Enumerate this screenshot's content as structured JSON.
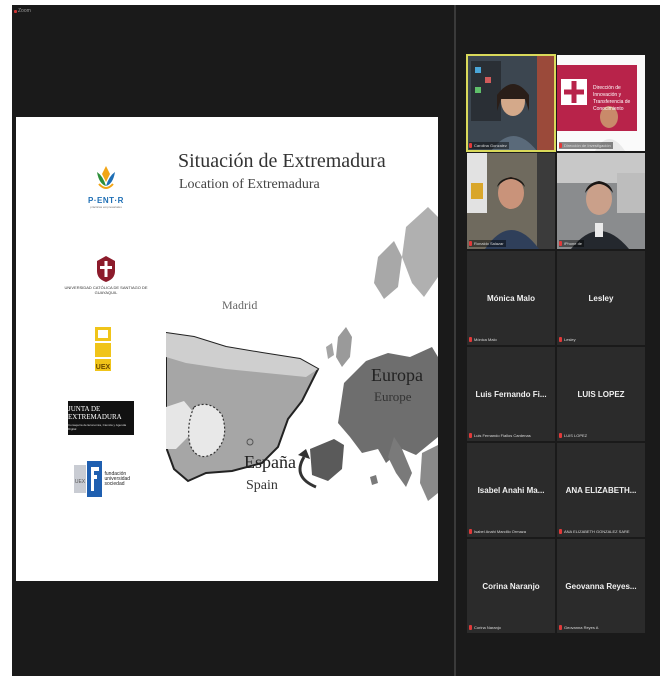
{
  "window": {
    "title": "Zoom"
  },
  "slide": {
    "title": "Situación de Extremadura",
    "subtitle": "Location of Extremadura",
    "labels": {
      "madrid": "Madrid",
      "europa": "Europa",
      "europe": "Europe",
      "espana": "España",
      "spain": "Spain"
    },
    "logos": {
      "pentor": {
        "name": "P·ENT·R",
        "tagline": "prácticas empresariales"
      },
      "ucsc": {
        "name": "UNIVERSIDAD CATÓLICA DE SANTIAGO DE GUAYAQUIL"
      },
      "uex": {
        "name": "UEX"
      },
      "junta": {
        "name": "JUNTA DE EXTREMADURA",
        "sub": "Consejería de Economía, Ciencia y Agenda Digital"
      },
      "fundacion": {
        "badge": "UEX",
        "text": "fundación universidad sociedad"
      }
    }
  },
  "participants": [
    {
      "name": "Carolina Gonzalez",
      "video": true,
      "active": true,
      "muted": true
    },
    {
      "name": "Dirección de Investigación",
      "video": true,
      "slide_text": "Dirección de Innovación y Transferencia de Conocimiento",
      "muted": true
    },
    {
      "name": "Ronaldo Salazar",
      "video": true,
      "muted": true
    },
    {
      "name": "iPhone de",
      "video": true,
      "muted": true
    },
    {
      "name": "Mónica Malo",
      "label": "Mónica Malo",
      "video": false,
      "muted": true
    },
    {
      "name": "Lesley",
      "label": "Lesley",
      "video": false,
      "muted": true
    },
    {
      "name": "Luis Fernando Fi...",
      "label": "Luis Fernando Fiallos Cardenas",
      "video": false,
      "muted": true
    },
    {
      "name": "LUIS LOPEZ",
      "label": "LUIS LOPEZ",
      "video": false,
      "muted": true
    },
    {
      "name": "Isabel Anahi Ma...",
      "label": "Isabel Anahi Marcillo Ormaza",
      "video": false,
      "muted": true
    },
    {
      "name": "ANA ELIZABETH...",
      "label": "ANA ELIZABETH GONZALEZ SARE",
      "video": false,
      "muted": true
    },
    {
      "name": "Corina Naranjo",
      "label": "Corina Naranjo",
      "video": false,
      "muted": true
    },
    {
      "name": "Geovanna Reyes...",
      "label": "Geovanna Reyes A",
      "video": false,
      "muted": true
    }
  ]
}
